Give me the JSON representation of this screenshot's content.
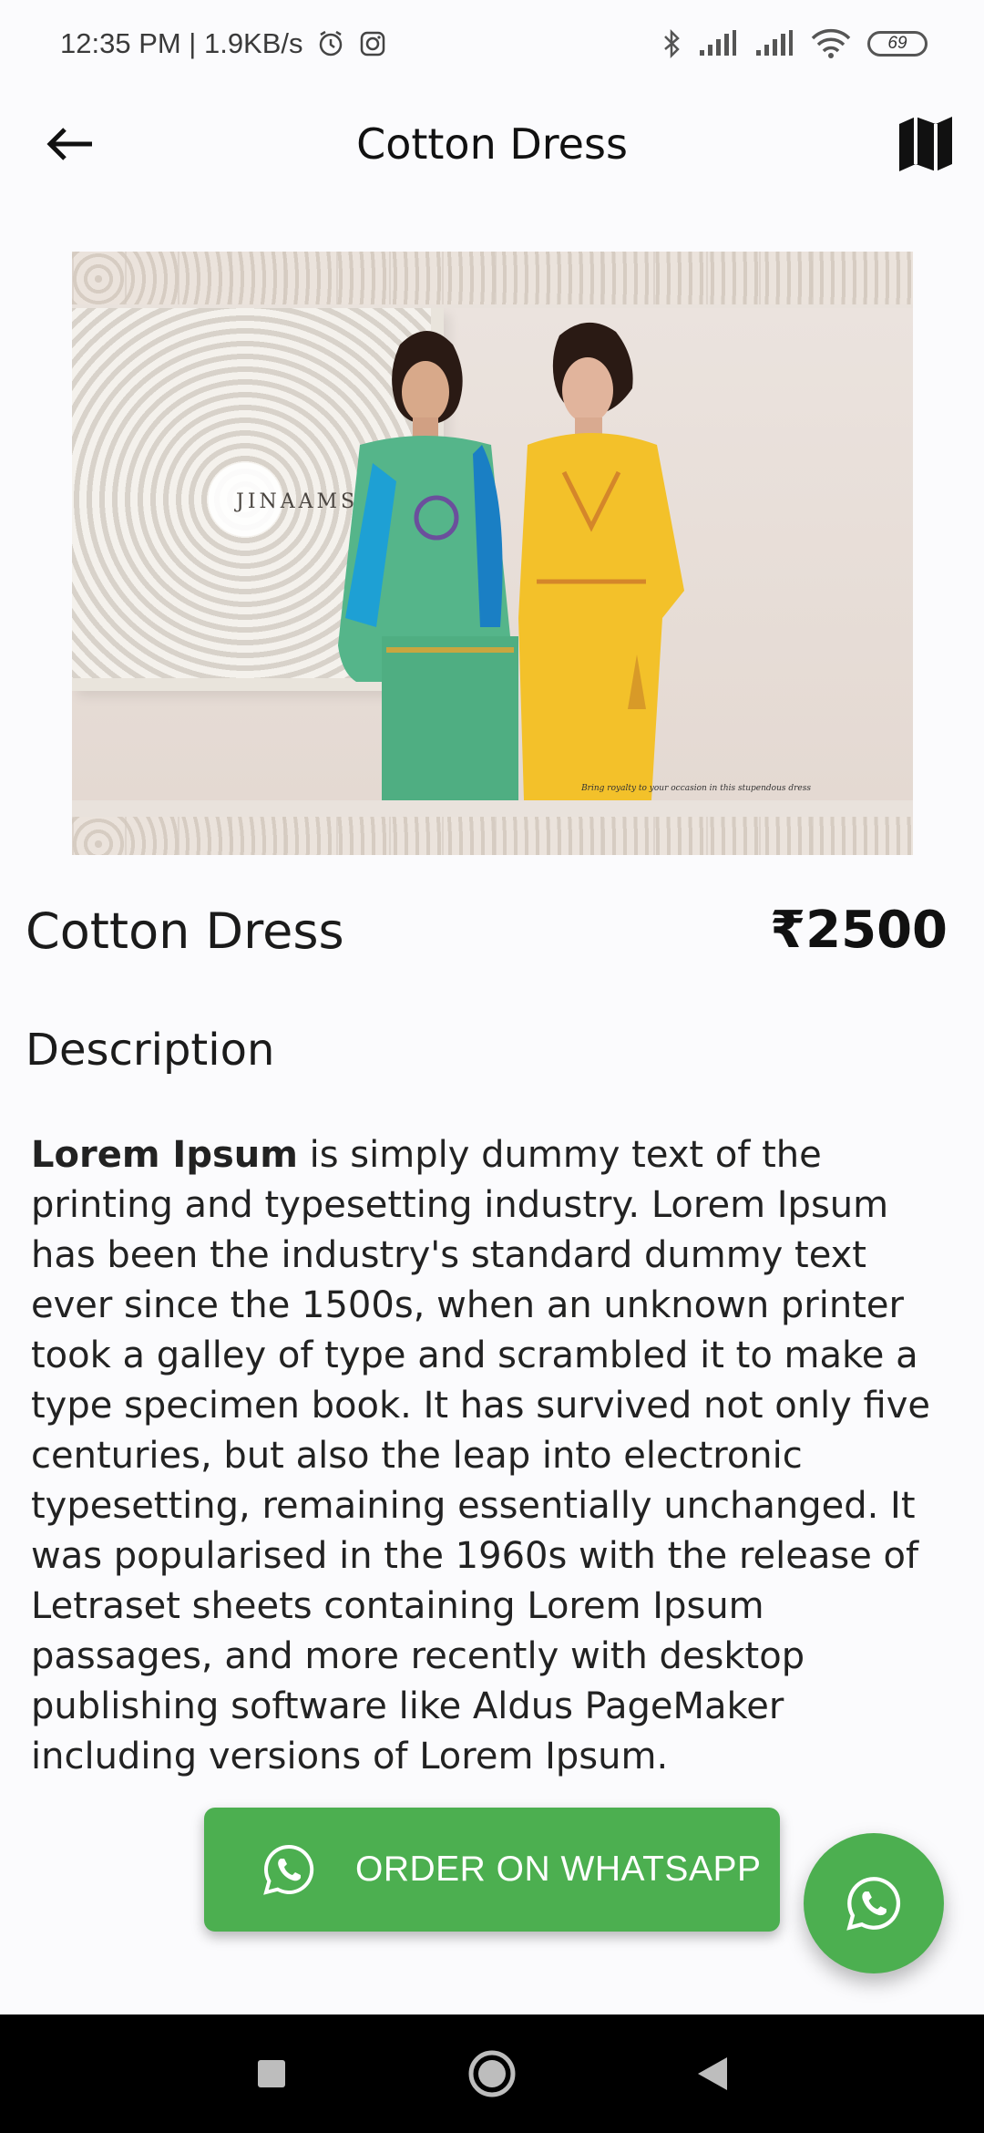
{
  "status_bar": {
    "time_speed": "12:35 PM | 1.9KB/s",
    "battery": "69",
    "icons": [
      "alarm-icon",
      "instagram-icon",
      "bluetooth-icon",
      "signal-icon",
      "signal-icon",
      "wifi-icon",
      "battery-icon"
    ]
  },
  "app_bar": {
    "title": "Cotton Dress",
    "back_icon": "arrow-left-icon",
    "action_icon": "map-icon"
  },
  "product": {
    "image": {
      "brand_mark": "JINAAMS",
      "tagline": "Bring royalty to your occasion in this stupendous dress"
    },
    "name": "Cotton Dress",
    "price": "₹2500"
  },
  "description": {
    "heading": "Description",
    "bold_lead": "Lorem Ipsum",
    "body": " is simply dummy text of the printing and typesetting industry. Lorem Ipsum has been the industry's standard dummy text ever since the 1500s, when an unknown printer took a galley of type and scrambled it to make a type specimen book. It has survived not only five centuries, but also the leap into electronic typesetting, remaining essentially unchanged. It was popularised in the 1960s with the release of Letraset sheets containing Lorem Ipsum passages, and more recently with desktop publishing software like Aldus PageMaker including versions of Lorem Ipsum."
  },
  "actions": {
    "order_label": "ORDER ON WHATSAPP",
    "order_icon": "whatsapp-icon",
    "fab_icon": "whatsapp-icon"
  },
  "colors": {
    "accent_green": "#4caf50",
    "background": "#fbfbfd",
    "nav_bar": "#000000"
  },
  "nav_bar": {
    "items": [
      "recents-icon",
      "home-icon",
      "back-icon"
    ]
  }
}
